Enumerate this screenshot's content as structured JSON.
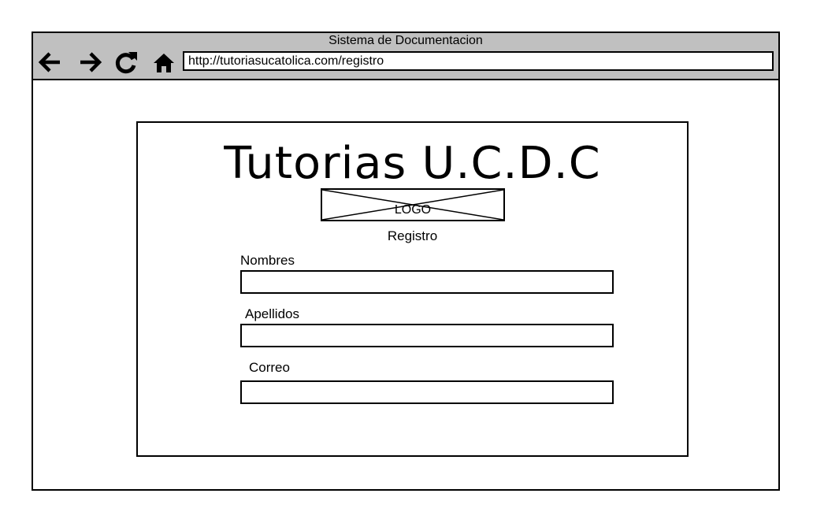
{
  "window": {
    "title": "Sistema de Documentacion",
    "url": "http://tutoriasucatolica.com/registro",
    "nav": [
      {
        "name": "back-icon"
      },
      {
        "name": "forward-icon"
      },
      {
        "name": "reload-icon"
      },
      {
        "name": "home-icon"
      }
    ]
  },
  "page": {
    "brand": "Tutorias U.C.D.C",
    "logo_text": "LOGO",
    "subtitle": "Registro",
    "fields": {
      "nombres": {
        "label": "Nombres",
        "value": ""
      },
      "apellidos": {
        "label": "Apellidos",
        "value": ""
      },
      "correo": {
        "label": "Correo",
        "value": ""
      }
    }
  }
}
